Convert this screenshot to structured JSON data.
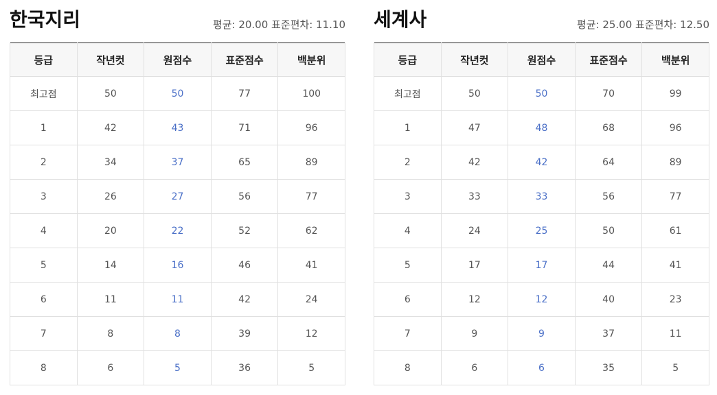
{
  "columns": [
    "등급",
    "작년컷",
    "원점수",
    "표준점수",
    "백분위"
  ],
  "left": {
    "title": "한국지리",
    "stats": "평균: 20.00 표준편차: 11.10",
    "rows": [
      [
        "최고점",
        "50",
        "50",
        "77",
        "100"
      ],
      [
        "1",
        "42",
        "43",
        "71",
        "96"
      ],
      [
        "2",
        "34",
        "37",
        "65",
        "89"
      ],
      [
        "3",
        "26",
        "27",
        "56",
        "77"
      ],
      [
        "4",
        "20",
        "22",
        "52",
        "62"
      ],
      [
        "5",
        "14",
        "16",
        "46",
        "41"
      ],
      [
        "6",
        "11",
        "11",
        "42",
        "24"
      ],
      [
        "7",
        "8",
        "8",
        "39",
        "12"
      ],
      [
        "8",
        "6",
        "5",
        "36",
        "5"
      ]
    ]
  },
  "right": {
    "title": "세계사",
    "stats": "평균: 25.00 표준편차: 12.50",
    "rows": [
      [
        "최고점",
        "50",
        "50",
        "70",
        "99"
      ],
      [
        "1",
        "47",
        "48",
        "68",
        "96"
      ],
      [
        "2",
        "42",
        "42",
        "64",
        "89"
      ],
      [
        "3",
        "33",
        "33",
        "56",
        "77"
      ],
      [
        "4",
        "24",
        "25",
        "50",
        "61"
      ],
      [
        "5",
        "17",
        "17",
        "44",
        "41"
      ],
      [
        "6",
        "12",
        "12",
        "40",
        "23"
      ],
      [
        "7",
        "9",
        "9",
        "37",
        "11"
      ],
      [
        "8",
        "6",
        "6",
        "35",
        "5"
      ]
    ]
  },
  "colors": {
    "raw_score_text": "#4a6fc7",
    "header_bg": "#f7f7f7",
    "grid_line": "#e0e0e0",
    "top_rule": "#222222"
  }
}
